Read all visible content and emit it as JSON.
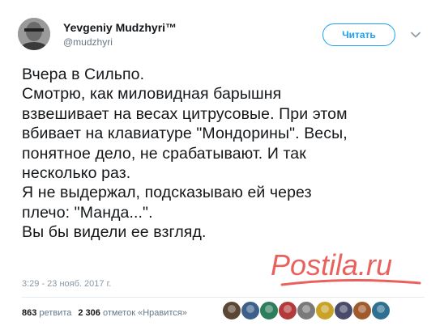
{
  "user": {
    "display_name": "Yevgeniy Mudzhyri™",
    "handle": "@mudzhyri"
  },
  "follow_button": {
    "label": "Читать"
  },
  "menu": {
    "icon": "chevron-down-icon"
  },
  "tweet": {
    "lines": [
      "Вчера в Сильпо.",
      "Смотрю, как миловидная барышня",
      "взвешивает на весах цитрусовые. При этом",
      "вбивает на клавиатуре \"Мондорины\". Весы,",
      "понятное дело, не срабатывают. И так",
      "несколько раз.",
      "Я не выдержал, подсказываю ей через",
      "плечо: \"Манда...\".",
      "Вы бы видели ее взгляд."
    ],
    "timestamp": "3:29 - 23 нояб. 2017 г."
  },
  "stats": {
    "retweets_count": "863",
    "retweets_label": "ретвита",
    "likes_count": "2 306",
    "likes_label": "отметок «Нравится»"
  },
  "likers": {
    "avatar_colors": [
      "#5a4632",
      "#3d5f8a",
      "#2e7d5b",
      "#b23a3a",
      "#7a7a7a",
      "#c9a227",
      "#4a4a6a",
      "#a05a2c",
      "#2f6f8f"
    ]
  },
  "watermark": {
    "text": "Postila.ru",
    "color": "#e53935"
  },
  "colors": {
    "accent": "#1da1f2",
    "text": "#14171a",
    "muted": "#657786"
  }
}
